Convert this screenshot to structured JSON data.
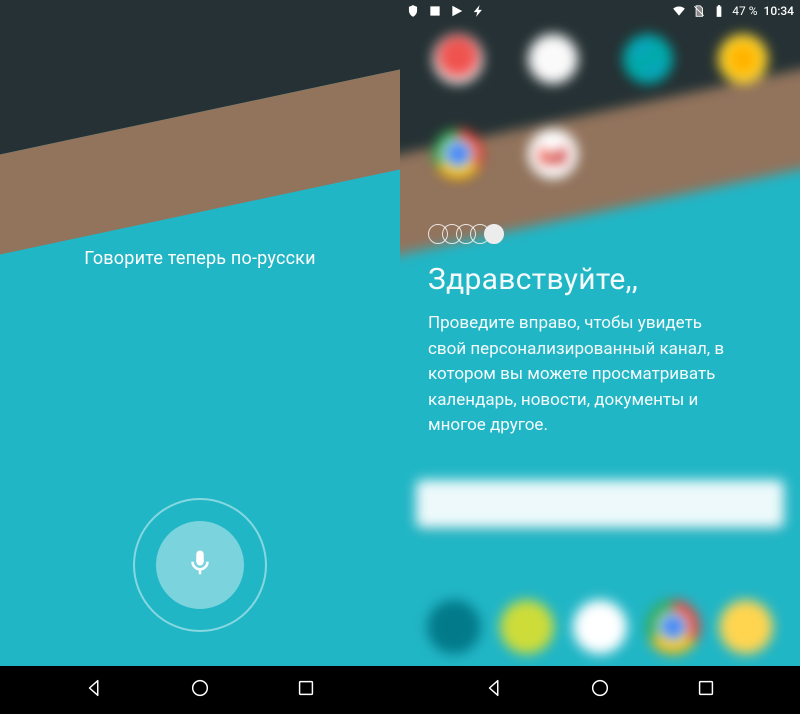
{
  "statusbar": {
    "battery_pct": "47 %",
    "clock": "10:34"
  },
  "left": {
    "voice_prompt": "Говорите теперь по-русски"
  },
  "right": {
    "popup": {
      "title": "Здравствуйте,,",
      "body": "Проведите вправо, чтобы увидеть свой персонализированный канал, в котором вы можете просматривать календарь, новости, документы и многое другое."
    }
  }
}
